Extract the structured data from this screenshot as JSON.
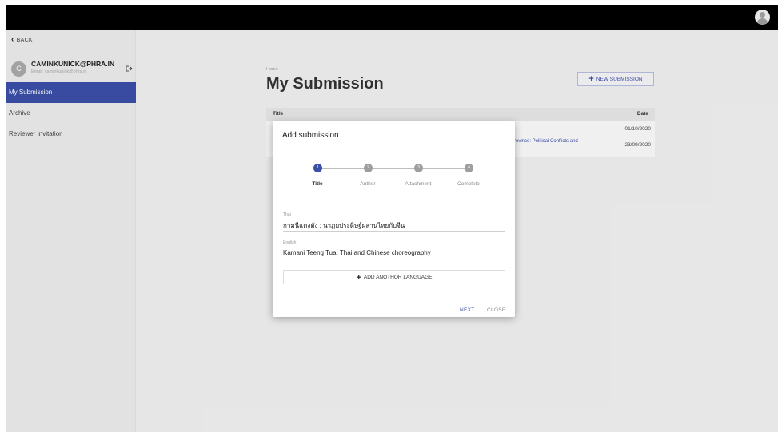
{
  "sidebar": {
    "back_label": "BACK",
    "user_initial": "C",
    "user_name": "CAMINKUNICK@PHRA.IN",
    "user_email": "Email: caminkunick@phra.in",
    "items": [
      {
        "label": "My Submission",
        "active": true
      },
      {
        "label": "Archive",
        "active": false
      },
      {
        "label": "Reviewer Invitation",
        "active": false
      }
    ]
  },
  "main": {
    "breadcrumb": "Home",
    "title": "My Submission",
    "new_submission_label": "NEW SUBMISSION",
    "table": {
      "headers": {
        "title": "Title",
        "date": "Date"
      },
      "rows": [
        {
          "title": "",
          "date": "01/10/2020"
        },
        {
          "title": "Province: Political Conflicts and",
          "date": "23/09/2020"
        }
      ]
    }
  },
  "modal": {
    "title": "Add submission",
    "steps": [
      {
        "num": "1",
        "label": "Title",
        "active": true
      },
      {
        "num": "2",
        "label": "Author",
        "active": false
      },
      {
        "num": "3",
        "label": "Attachment",
        "active": false
      },
      {
        "num": "4",
        "label": "Complete",
        "active": false
      }
    ],
    "fields": [
      {
        "label": "Thai",
        "value": "กามนีแตงตัง : นาฏยประดิษฐ์ผสานไทยกับจีน"
      },
      {
        "label": "English",
        "value": "Kamani Teeng Tua: Thai and Chinese choreography"
      }
    ],
    "add_language_label": "ADD ANOTHOR LANGUAGE",
    "next_label": "NEXT",
    "close_label": "CLOSE"
  },
  "colors": {
    "accent": "#3b4fa8",
    "topbar": "#000000"
  }
}
